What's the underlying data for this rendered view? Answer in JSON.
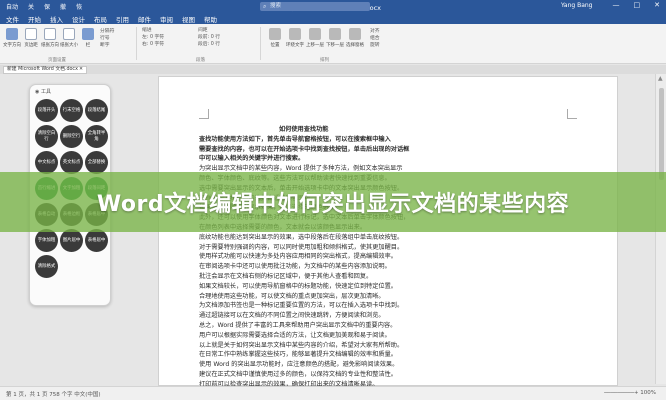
{
  "titlebar": {
    "quick": [
      "自动",
      "关",
      "保",
      "撤",
      "恢"
    ],
    "title": "新建 Microsoft Word 文档.docx",
    "search": "搜索",
    "user": "Yang Bang",
    "min": "—",
    "max": "□",
    "close": "✕"
  },
  "menu": [
    "文件",
    "开始",
    "插入",
    "设计",
    "布局",
    "引用",
    "邮件",
    "审阅",
    "视图",
    "帮助"
  ],
  "ribbon": {
    "buttons": [
      {
        "label": "文字方向"
      },
      {
        "label": "页边距"
      },
      {
        "label": "纸张方向"
      },
      {
        "label": "纸张大小"
      },
      {
        "label": "栏"
      },
      {
        "label": "分隔符"
      },
      {
        "label": "行号"
      },
      {
        "label": "断字"
      }
    ],
    "indent_label": "缩进",
    "indent_items": [
      "左: 0 字符",
      "右: 0 字符"
    ],
    "spacing_label": "间距",
    "spacing_items": [
      "段前: 0 行",
      "段后: 0 行"
    ],
    "arrange": [
      {
        "label": "位置"
      },
      {
        "label": "环绕文字"
      },
      {
        "label": "上移一层"
      },
      {
        "label": "下移一层"
      },
      {
        "label": "选择窗格"
      }
    ],
    "arrange_items": [
      "对齐",
      "组合",
      "旋转"
    ],
    "group_page": "页面设置",
    "group_para": "段落",
    "group_arrange": "排列"
  },
  "doc_tab": {
    "label": "新建 Microsoft Word 文档.docx",
    "close": "✕"
  },
  "panel": {
    "title": "工具",
    "buttons": [
      {
        "label": "段落开头",
        "green": false
      },
      {
        "label": "行末空格",
        "green": false
      },
      {
        "label": "段落结尾",
        "green": false
      },
      {
        "label": "清除空白行",
        "green": false
      },
      {
        "label": "删除空行",
        "green": false
      },
      {
        "label": "全角转半角",
        "green": false
      },
      {
        "label": "中文标点",
        "green": false
      },
      {
        "label": "英文标点",
        "green": false
      },
      {
        "label": "全部替换",
        "green": false
      },
      {
        "label": "首行缩进",
        "green": true
      },
      {
        "label": "文字加粗",
        "green": true
      },
      {
        "label": "段落间距",
        "green": true
      },
      {
        "label": "表格自动",
        "green": false
      },
      {
        "label": "表格边框",
        "green": false
      },
      {
        "label": "表格居中",
        "green": false
      },
      {
        "label": "字体加粗",
        "green": false
      },
      {
        "label": "图片居中",
        "green": false
      },
      {
        "label": "表格居中",
        "green": false
      },
      {
        "label": "清除格式",
        "green": false
      }
    ]
  },
  "doc": {
    "lines": [
      {
        "text": "如何使用查找功能",
        "bold": true
      },
      {
        "text": "查找功能使用方法如下，首先单击导航窗格按钮，可以在搜索框中输入",
        "bold": true
      },
      {
        "text": "需要查找的内容，也可以在开始选项卡中找到查找按钮，单击后出现的对话框",
        "bold": true
      },
      {
        "text": "中可以输入相关的关键字并进行搜索。",
        "bold": true
      },
      {
        "text": "为突出显示文档中的某些内容，Word 提供了多种方法，例如文本突出显示",
        "bold": false
      },
      {
        "text": "颜色、字体颜色、底纹等。这些方法可以帮助读者快速找到重要信息。",
        "bold": false
      },
      {
        "text": "选中需要突出显示的文本后，单击开始选项卡中的文本突出显示颜色按钮。",
        "bold": false
      },
      {
        "text": "在弹出的下拉列表中选择合适的颜色即可。",
        "bold": false
      },
      {
        "text": "如果需要删除突出显示效果，可以选择无颜色选项。",
        "bold": false
      },
      {
        "text": "此外，还可以使用字体颜色对文本进行标记，选中文本后单击字体颜色按钮，",
        "bold": false
      },
      {
        "text": "在颜色列表中选择需要的颜色，文本就会以该颜色显示出来。",
        "bold": false
      },
      {
        "text": "底纹功能也能达到突出显示的效果，选中段落后在段落组中单击底纹按钮。",
        "bold": false
      },
      {
        "text": "对于需要特别强调的内容，可以同时使用加粗和倾斜格式，使其更加醒目。",
        "bold": false
      },
      {
        "text": "使用样式功能可以快速为多处内容应用相同的突出格式，提高编辑效率。",
        "bold": false
      },
      {
        "text": "在审阅选项卡中还可以使用批注功能，为文档中的某些内容添加说明。",
        "bold": false
      },
      {
        "text": "批注会显示在文档右侧的标记区域中，便于其他人查看和回复。",
        "bold": false
      },
      {
        "text": "如果文档较长，可以使用导航窗格中的标题功能，快速定位到特定位置。",
        "bold": false
      },
      {
        "text": "合理地使用这些功能，可以使文档的重点更加突出，层次更加清晰。",
        "bold": false
      },
      {
        "text": "为文档添加书签也是一种标记重要位置的方法，可以在插入选项卡中找到。",
        "bold": false
      },
      {
        "text": "通过超链接可以在文档的不同位置之间快速跳转，方便阅读和浏览。",
        "bold": false
      },
      {
        "text": "总之，Word 提供了丰富的工具来帮助用户突出显示文档中的重要内容。",
        "bold": false
      },
      {
        "text": "用户可以根据实际需要选择合适的方法，让文档更加美观和易于阅读。",
        "bold": false
      },
      {
        "text": "以上就是关于如何突出显示文档中某些内容的介绍，希望对大家有所帮助。",
        "bold": false
      },
      {
        "text": "在日常工作中熟练掌握这些技巧，能够显著提升文档编辑的效率和质量。",
        "bold": false
      },
      {
        "text": "使用 Word 的突出显示功能时，应注意颜色的搭配，避免影响阅读效果。",
        "bold": false
      },
      {
        "text": "建议在正式文档中谨慎使用过多的颜色，以保持文档的专业性和整洁性。",
        "bold": false
      },
      {
        "text": "打印前可以检查突出显示的效果，确保打印出来的文档清晰易读。",
        "bold": false
      }
    ]
  },
  "status": {
    "left": "第 1 页，共 1 页    758 个字    中文(中国)",
    "right": "─────────+   100%"
  },
  "banner": {
    "text": "Word文档编辑中如何突出显示文档的某些内容"
  }
}
